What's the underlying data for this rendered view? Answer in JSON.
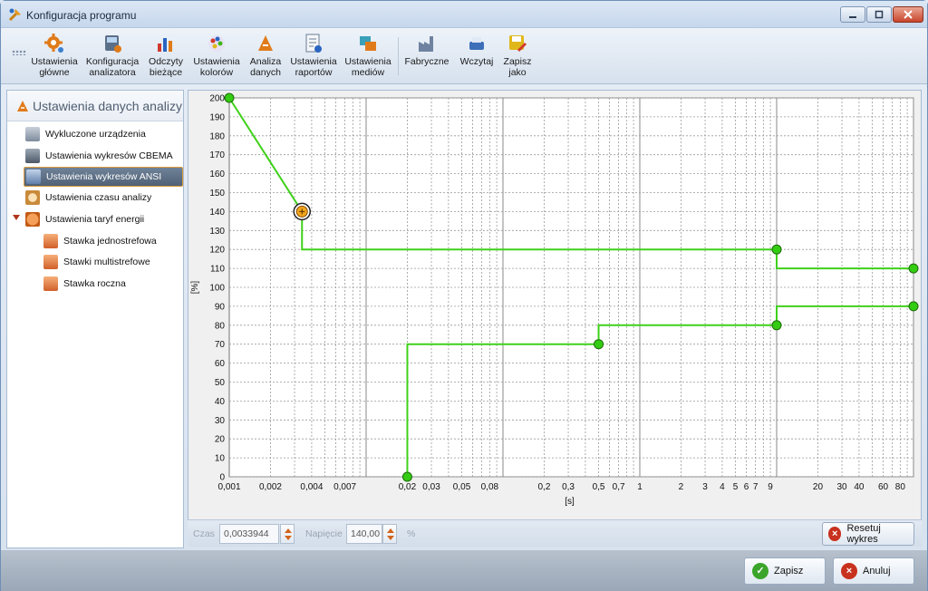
{
  "window": {
    "title": "Konfiguracja programu",
    "icon": "app-tools-icon"
  },
  "toolbar": {
    "buttons": [
      {
        "label": "Ustawienia\ngłówne",
        "icon": "gear-icon"
      },
      {
        "label": "Konfiguracja\nanalizatora",
        "icon": "analyzer-icon"
      },
      {
        "label": "Odczyty\nbieżące",
        "icon": "bar-chart-icon"
      },
      {
        "label": "Ustawienia\nkolorów",
        "icon": "palette-icon"
      },
      {
        "label": "Analiza\ndanych",
        "icon": "data-analysis-icon"
      },
      {
        "label": "Ustawienia\nraportów",
        "icon": "report-icon"
      },
      {
        "label": "Ustawienia\nmediów",
        "icon": "media-icon"
      },
      {
        "label": "Fabryczne",
        "icon": "factory-icon"
      },
      {
        "label": "Wczytaj",
        "icon": "load-icon"
      },
      {
        "label": "Zapisz\njako",
        "icon": "save-as-icon"
      }
    ]
  },
  "sidebar": {
    "header": "Ustawienia danych analizy",
    "items": [
      {
        "label": "Wykluczone urządzenia",
        "icon": "excluded-devices-icon",
        "level": 0
      },
      {
        "label": "Ustawienia wykresów CBEMA",
        "icon": "cbema-chart-icon",
        "level": 0
      },
      {
        "label": "Ustawienia wykresów ANSI",
        "icon": "ansi-chart-icon",
        "level": 0,
        "selected": true
      },
      {
        "label": "Ustawienia czasu analizy",
        "icon": "clock-icon",
        "level": 0
      },
      {
        "label": "Ustawienia taryf energii",
        "icon": "tariff-icon",
        "level": 0,
        "expanded": true
      },
      {
        "label": "Stawka jednostrefowa",
        "icon": "rate-icon",
        "level": 1
      },
      {
        "label": "Stawki multistrefowe",
        "icon": "rate-icon",
        "level": 1
      },
      {
        "label": "Stawka roczna",
        "icon": "rate-icon",
        "level": 1
      }
    ]
  },
  "chart_data": {
    "type": "line",
    "xscale": "log",
    "xlim": [
      0.001,
      100
    ],
    "ylim": [
      0,
      200
    ],
    "xlabel": "[s]",
    "ylabel": "[%]",
    "grid": true,
    "yticks": [
      0,
      10,
      20,
      30,
      40,
      50,
      60,
      70,
      80,
      90,
      100,
      110,
      120,
      130,
      140,
      150,
      160,
      170,
      180,
      190,
      200
    ],
    "xtick_labels": [
      {
        "v": 0.001,
        "t": "0,001"
      },
      {
        "v": 0.002,
        "t": "0,002"
      },
      {
        "v": 0.004,
        "t": "0,004"
      },
      {
        "v": 0.007,
        "t": "0,007"
      },
      {
        "v": 0.02,
        "t": "0,02"
      },
      {
        "v": 0.03,
        "t": "0,03"
      },
      {
        "v": 0.05,
        "t": "0,05"
      },
      {
        "v": 0.08,
        "t": "0,08"
      },
      {
        "v": 0.2,
        "t": "0,2"
      },
      {
        "v": 0.3,
        "t": "0,3"
      },
      {
        "v": 0.5,
        "t": "0,5"
      },
      {
        "v": 0.7,
        "t": "0,7"
      },
      {
        "v": 1,
        "t": "1"
      },
      {
        "v": 2,
        "t": "2"
      },
      {
        "v": 3,
        "t": "3"
      },
      {
        "v": 4,
        "t": "4"
      },
      {
        "v": 5,
        "t": "5"
      },
      {
        "v": 6,
        "t": "6"
      },
      {
        "v": 7,
        "t": "7"
      },
      {
        "v": 9,
        "t": "9"
      },
      {
        "v": 20,
        "t": "20"
      },
      {
        "v": 30,
        "t": "30"
      },
      {
        "v": 40,
        "t": "40"
      },
      {
        "v": 60,
        "t": "60"
      },
      {
        "v": 80,
        "t": "80"
      }
    ],
    "series": [
      {
        "line": [
          [
            0.001,
            200
          ],
          [
            0.0034,
            140
          ],
          [
            0.0034,
            120
          ],
          [
            10,
            120
          ],
          [
            10,
            110
          ],
          [
            100,
            110
          ]
        ],
        "points": [
          [
            0.001,
            200
          ],
          [
            10,
            120
          ],
          [
            100,
            110
          ]
        ]
      },
      {
        "line": [
          [
            0.02,
            0
          ],
          [
            0.02,
            70
          ],
          [
            0.5,
            70
          ],
          [
            0.5,
            80
          ],
          [
            10,
            80
          ],
          [
            10,
            90
          ],
          [
            100,
            90
          ]
        ],
        "points": [
          [
            0.02,
            0
          ],
          [
            0.5,
            70
          ],
          [
            10,
            80
          ],
          [
            100,
            90
          ]
        ]
      }
    ],
    "selected_point": [
      0.0034,
      140
    ],
    "line_color": "#3fd11a",
    "point_color": "#33cc12"
  },
  "editor": {
    "time_label": "Czas",
    "time_value": "0,0033944",
    "voltage_label": "Napięcie",
    "voltage_value": "140,00",
    "unit": "%",
    "reset_label": "Resetuj wykres"
  },
  "dialog": {
    "save_label": "Zapisz",
    "cancel_label": "Anuluj"
  }
}
